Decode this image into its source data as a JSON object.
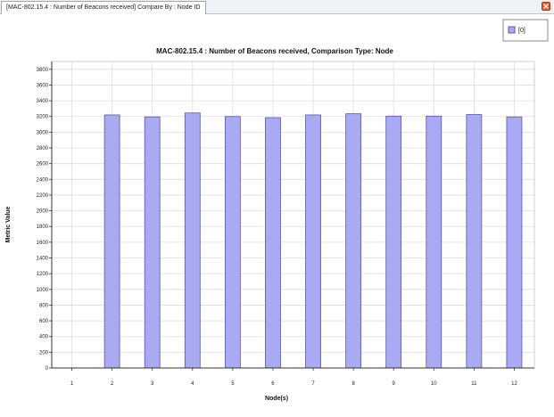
{
  "tab": {
    "label": "[MAC-802.15.4 : Number of Beacons received] Compare By : Node ID"
  },
  "colors": {
    "bar_fill": "#aaaaf2",
    "bar_stroke": "#5555aa",
    "grid": "#dcdcdc",
    "close": "#e0572b"
  },
  "chart_data": {
    "type": "bar",
    "title": "MAC-802.15.4 :  Number of Beacons received, Comparison Type: Node",
    "xlabel": "Node(s)",
    "ylabel": "Metric Value",
    "categories": [
      "1",
      "2",
      "3",
      "4",
      "5",
      "6",
      "7",
      "8",
      "9",
      "10",
      "11",
      "12"
    ],
    "series": [
      {
        "name": "[0]",
        "values": [
          0,
          3220,
          3195,
          3245,
          3200,
          3185,
          3220,
          3235,
          3205,
          3205,
          3225,
          3195
        ]
      }
    ],
    "ylim": [
      0,
      3900
    ],
    "yticks": [
      0,
      200,
      400,
      600,
      800,
      1000,
      1200,
      1400,
      1600,
      1800,
      2000,
      2200,
      2400,
      2600,
      2800,
      3000,
      3200,
      3400,
      3600,
      3800
    ],
    "grid": true,
    "legend_position": "top-right"
  }
}
